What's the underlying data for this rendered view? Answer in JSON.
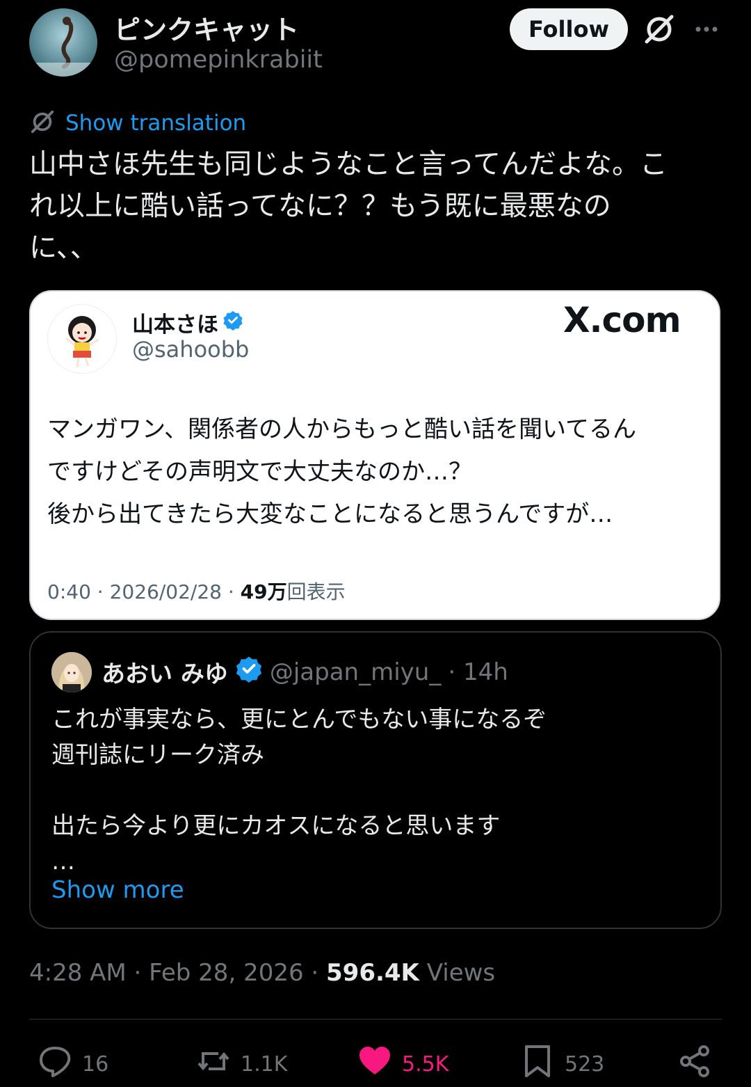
{
  "header": {
    "display_name": "ピンクキャット",
    "handle": "@pomepinkrabiit",
    "follow_label": "Follow"
  },
  "translation": {
    "label": "Show translation"
  },
  "tweet": {
    "text": "山中さほ先生も同じようなこと言ってんだよな。こ\nれ以上に酷い話ってなに？？もう既に最悪なの\nに、、"
  },
  "embedded_image": {
    "name": "山本さほ",
    "handle": "@sahoobb",
    "site": "X.com",
    "text": "マンガワン、関係者の人からもっと酷い話を聞いてるん\nですけどその声明文で大丈夫なのか…？\n後から出てきたら大変なことになると思うんですが…",
    "meta_prefix": "0:40 · 2026/02/28 · ",
    "views_number": "49万",
    "views_label": "回表示"
  },
  "quote": {
    "name": "あおい みゆ",
    "handle": "@japan_miyu_",
    "time": "· 14h",
    "text": "これが事実なら、更にとんでもない事になるぞ\n週刊誌にリーク済み\n\n出たら今より更にカオスになると思います\n…",
    "show_more": "Show more"
  },
  "post_meta": {
    "time": "4:28 AM · Feb 28, 2026 · ",
    "views_count": "596.4K",
    "views_label": " Views"
  },
  "actions": {
    "replies": "16",
    "reposts": "1.1K",
    "likes": "5.5K",
    "bookmarks": "523"
  },
  "colors": {
    "accent": "#1d9bf0",
    "like": "#f91880",
    "verified": "#1d9bf0"
  }
}
